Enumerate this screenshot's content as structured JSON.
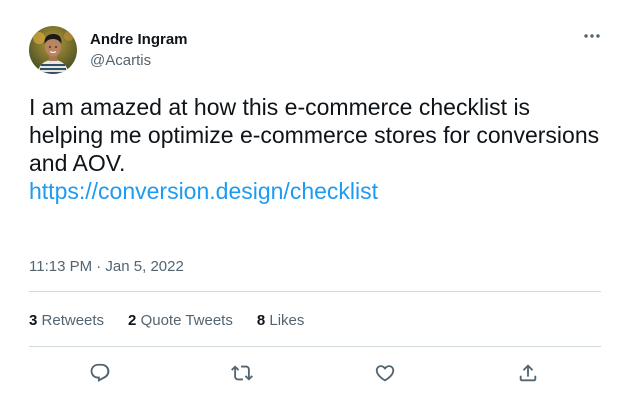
{
  "author": {
    "display_name": "Andre Ingram",
    "handle": "@Acartis",
    "avatar_icon": "profile-photo"
  },
  "menu": {
    "icon": "more-horizontal-icon"
  },
  "tweet": {
    "text": "I am amazed at how this e-commerce checklist is helping me optimize e-commerce stores for conversions and AOV.",
    "link": "https://conversion.design/checklist",
    "timestamp": "11:13 PM · Jan 5, 2022"
  },
  "stats": {
    "retweets": {
      "count": "3",
      "label": "Retweets"
    },
    "quote_tweets": {
      "count": "2",
      "label": "Quote Tweets"
    },
    "likes": {
      "count": "8",
      "label": "Likes"
    }
  },
  "actions": [
    {
      "name": "reply",
      "icon": "reply-icon"
    },
    {
      "name": "retweet",
      "icon": "retweet-icon"
    },
    {
      "name": "like",
      "icon": "heart-icon"
    },
    {
      "name": "share",
      "icon": "share-icon"
    }
  ],
  "colors": {
    "link": "#1d9bf0",
    "text": "#0f1419",
    "secondary": "#536471",
    "divider": "#cfd9de"
  }
}
